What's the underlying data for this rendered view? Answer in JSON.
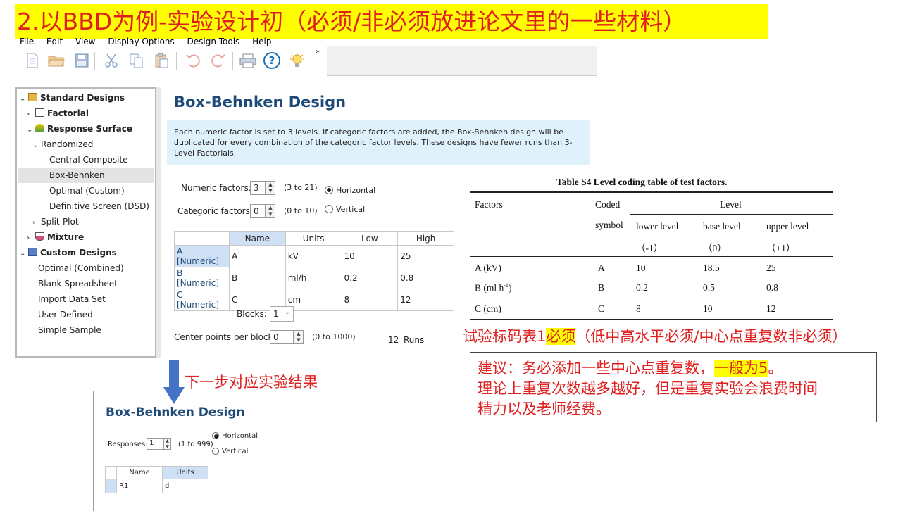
{
  "banner": {
    "title": "2.以BBD为例-实验设计初（必须/非必须放进论文里的一些材料）"
  },
  "menu": [
    "File",
    "Edit",
    "View",
    "Display Options",
    "Design Tools",
    "Help"
  ],
  "tree": {
    "standard": "Standard Designs",
    "factorial": "Factorial",
    "response_surface": "Response Surface",
    "randomized": "Randomized",
    "central_composite": "Central Composite",
    "box_behnken": "Box-Behnken",
    "optimal_custom": "Optimal (Custom)",
    "definitive": "Definitive Screen (DSD)",
    "split_plot": "Split-Plot",
    "mixture": "Mixture",
    "custom": "Custom Designs",
    "optimal_combined": "Optimal (Combined)",
    "blank": "Blank Spreadsheet",
    "import": "Import Data Set",
    "user_defined": "User-Defined",
    "simple_sample": "Simple Sample"
  },
  "main": {
    "title": "Box-Behnken Design",
    "info": "Each numeric factor is set to 3 levels. If categoric factors are added, the Box-Behnken design will be duplicated for every combination of the categoric factor levels. These designs have fewer runs than 3-Level Factorials.",
    "numeric_label": "Numeric factors:",
    "numeric_value": "3",
    "numeric_range": "(3 to 21)",
    "categoric_label": "Categoric factors:",
    "categoric_value": "0",
    "categoric_range": "(0 to 10)",
    "horizontal": "Horizontal",
    "vertical": "Vertical",
    "headers": [
      "Name",
      "Units",
      "Low",
      "High"
    ],
    "rows": [
      {
        "label": "A [Numeric]",
        "name": "A",
        "units": "kV",
        "low": "10",
        "high": "25"
      },
      {
        "label": "B [Numeric]",
        "name": "B",
        "units": "ml/h",
        "low": "0.2",
        "high": "0.8"
      },
      {
        "label": "C [Numeric]",
        "name": "C",
        "units": "cm",
        "low": "8",
        "high": "12"
      }
    ],
    "blocks_label": "Blocks:",
    "blocks_value": "1",
    "center_label": "Center points per block:",
    "center_value": "0",
    "center_range": "(0 to 1000)",
    "runs_value": "12",
    "runs_label": "Runs"
  },
  "paper_table": {
    "caption": "Table S4 Level coding table of test factors.",
    "h_factors": "Factors",
    "h_coded": "Coded",
    "h_symbol": "symbol",
    "h_level": "Level",
    "h_lower": "lower level",
    "h_base": "base level",
    "h_upper": "upper level",
    "c_lower": "（-1）",
    "c_base": "（0）",
    "c_upper": "（+1）",
    "rows": [
      {
        "factor": "A (kV)",
        "symbol": "A",
        "lower": "10",
        "base": "18.5",
        "upper": "25"
      },
      {
        "factor": "B (ml h",
        "sup": "-1",
        "factor_end": ")",
        "symbol": "B",
        "lower": "0.2",
        "base": "0.5",
        "upper": "0.8"
      },
      {
        "factor": "C (cm)",
        "symbol": "C",
        "lower": "8",
        "base": "10",
        "upper": "12"
      }
    ]
  },
  "annotation": {
    "table_note_a": "试验标码表1",
    "table_note_b": "必须",
    "table_note_c": "（低中高水平必须/中心点重复数非必须）",
    "next_step": "下一步对应实验结果",
    "advice_a": "建议：务必添加一些中心点重复数，",
    "advice_hl": "一般为5",
    "advice_b": "。",
    "advice_line2": "理论上重复次数越多越好，但是重复实验会浪费时间",
    "advice_line3": "精力以及老师经费。"
  },
  "panel2": {
    "title": "Box-Behnken Design",
    "responses_label": "Responses:",
    "responses_value": "1",
    "responses_range": "(1 to 999)",
    "horizontal": "Horizontal",
    "vertical": "Vertical",
    "headers": [
      "Name",
      "Units"
    ],
    "row_name": "R1",
    "row_units": "d"
  },
  "colors": {
    "accent": "#1e4a78",
    "highlight": "#ffff00",
    "note_red": "#e02020",
    "info_bg": "#dff2fb"
  }
}
